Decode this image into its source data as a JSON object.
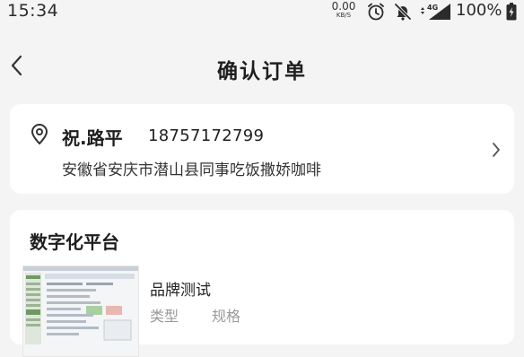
{
  "status_bar": {
    "time": "15:34",
    "net_speed_value": "0.00",
    "net_speed_unit": "KB/S",
    "network_type": "4G",
    "battery": "100%",
    "icons": [
      "alarm-icon",
      "mute-icon",
      "signal-icon",
      "battery-icon"
    ]
  },
  "nav": {
    "title": "确认订单",
    "back_icon": "chevron-left-icon"
  },
  "address": {
    "name": "祝.路平",
    "phone": "18757172799",
    "detail": "安徽省安庆市潜山县同事吃饭撒娇咖啡",
    "icon": "location-pin-icon"
  },
  "shop": {
    "name": "数字化平台",
    "product": {
      "name": "品牌测试",
      "type_label": "类型",
      "spec_label": "规格"
    }
  },
  "colors": {
    "background": "#f4f4f4",
    "card": "#ffffff",
    "muted_text": "#9a9a9a"
  }
}
